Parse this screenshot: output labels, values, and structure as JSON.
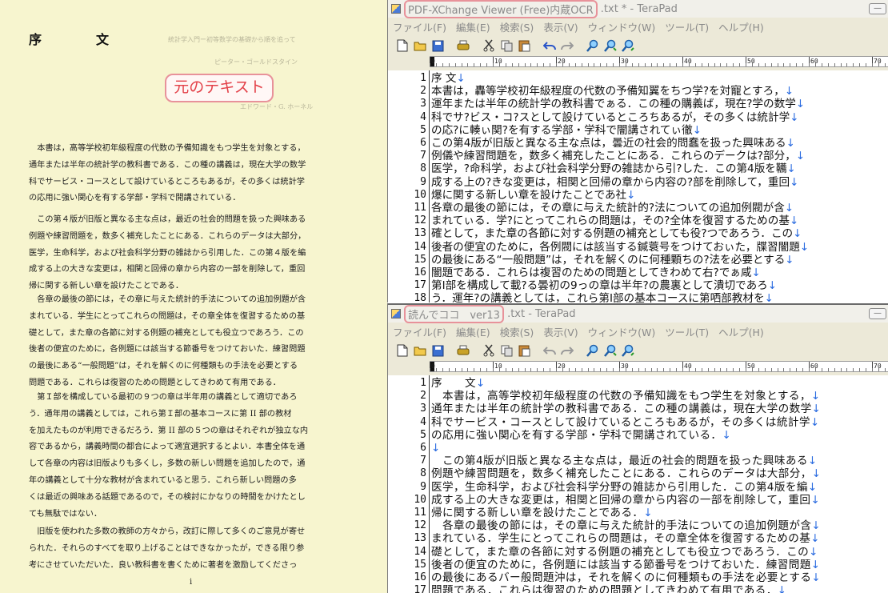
{
  "scan": {
    "heading": "序　文",
    "ghost_lines": [
      "統計学入門ー初等数学の基礎から順を追って",
      "ピーター・ゴールドスタイン",
      "エドワード・G. ホーネル"
    ],
    "callout": "元のテキスト",
    "paragraphs": [
      [
        "本書は，高等学校初年級程度の代数の予備知識をもつ学生を対象とする，",
        "通年または半年の統計学の教科書である．この種の講義は，現在大学の数学",
        "科でサービス・コースとして設けているところもあるが，その多くは統計学",
        "の応用に強い関心を有する学部・学科で開講されている．"
      ],
      [
        "この第４版が旧版と異なる主な点は，最近の社会的問題を扱った興味ある",
        "例題や練習問題を，数多く補充したことにある．これらのデータは大部分，",
        "医学，生命科学，および社会科学分野の雑誌から引用した．この第４版を編",
        "成する上の大きな変更は，相関と回帰の章から内容の一部を削除して，重回",
        "帰に関する新しい章を設けたことである．"
      ],
      [
        "各章の最後の節には，その章に与えた統計的手法についての追加例題が含",
        "まれている．学生にとってこれらの問題は，その章全体を復習するための基",
        "礎として，また章の各節に対する例題の補充としても役立つであろう．この",
        "後者の便宜のために，各例題には該当する節番号をつけておいた．練習問題",
        "の最後にある“一般問題”は，それを解くのに何種類もの手法を必要とする",
        "問題である．これらは復習のための問題としてきわめて有用である．"
      ],
      [
        "第Ｉ部を構成している最初の９つの章は半年用の講義として適切であろ",
        "う．通年用の講義としては，これら第Ｉ部の基本コースに第 II 部の教材",
        "を加えたものが利用できるだろう．第 II 部の５つの章はそれぞれが独立な内",
        "容であるから，講義時間の都合によって適宜選択するとよい．本書全体を通",
        "して各章の内容は旧版よりも多くし，多数の新しい問題を追加したので，通",
        "年の講義として十分な教材が含まれていると思う．これら新しい問題の多",
        "くは最近の興味ある話題であるので，その検討にかなりの時間をかけたとし",
        "ても無駄ではない．"
      ],
      [
        "旧版を使われた多数の教師の方々から，改訂に際して多くのご意見が寄せ",
        "られた．それらのすべてを取り上げることはできなかったが，できる限り参",
        "考にさせていただいた．良い教科書を書くために著者を激励してくださっ"
      ]
    ],
    "page_number": "i"
  },
  "window1": {
    "title_highlight": "PDF-XChange Viewer (Free)内蔵OCR",
    "title_rest": " .txt * - TeraPad",
    "menu": [
      "ファイル(F)",
      "編集(E)",
      "検索(S)",
      "表示(V)",
      "ウィンドウ(W)",
      "ツール(T)",
      "ヘルプ(H)"
    ],
    "ruler_marks": [
      "0",
      "10",
      "20",
      "30",
      "40",
      "50",
      "60",
      "70"
    ],
    "lines": [
      {
        "n": "1",
        "t": "序 文",
        "nl": "↓"
      },
      {
        "n": "2",
        "t": "本書は，轟等学校初年級程度の代数の予備知翼をちつ学?を対寵とすろ，",
        "nl": "↓"
      },
      {
        "n": "3",
        "t": "運年または半年の統計学の教科書でぁる．この種の購義ば，現在?学の数学",
        "nl": "↓"
      },
      {
        "n": "4",
        "t": "科でサ?ビス・コ?スとして設けているところちあるが，その多くは統計学",
        "nl": "↓"
      },
      {
        "n": "5",
        "t": "の応?に輳ぃ関?を有する学部・学科で闇講されてぃ徹",
        "nl": "↓"
      },
      {
        "n": "6",
        "t": "この第4版が旧版と異なる主な点は，曇近の社会的問蠢を扱った興味ある",
        "nl": "↓"
      },
      {
        "n": "7",
        "t": "例儀や練習問題を，数多く補充したことにある．これらのデークは?部分，",
        "nl": "↓"
      },
      {
        "n": "8",
        "t": "医学，?命科学，および社会科学分野の雑誌から引?した．この第4版を韉",
        "nl": "↓"
      },
      {
        "n": "9",
        "t": "成する上の?きな変更は，相関と回帰の章から内容の?部を削除して，重回",
        "nl": "↓"
      },
      {
        "n": "10",
        "t": "爆に関する新しい章を設けたことであ社",
        "nl": "↓"
      },
      {
        "n": "11",
        "t": "各章の最後の節には，その章に与えた統計的?法についての追加例閥が含",
        "nl": "↓"
      },
      {
        "n": "12",
        "t": "まれてぃる．学?にとってこれらの問題は，その?全体を復習するための基",
        "nl": "↓"
      },
      {
        "n": "13",
        "t": "確として，また章の各節に対する例題の補充としても役?つであろう．この",
        "nl": "↓"
      },
      {
        "n": "14",
        "t": "後者の便宜のために，各例閥には該当する鍼蓑号をつけておぃた，牒習闇題",
        "nl": "↓"
      },
      {
        "n": "15",
        "t": "の最後にある“一般問題”は，それを解くのに何種顆ちの?法を必要とする",
        "nl": "↓"
      },
      {
        "n": "16",
        "t": "闇題である．これらは複習のための問題としてきわめて右?でぁ咸",
        "nl": "↓"
      },
      {
        "n": "17",
        "t": "第I部を構成して載?る曇初の9っの章は半年?の農裏として潰切であろ",
        "nl": "↓"
      },
      {
        "n": "18",
        "t": "う．運年?の講義としては，これら第I部の基本コースに第哂部教材を",
        "nl": "↓"
      }
    ]
  },
  "window2": {
    "title_highlight": "読んでココ　ver13",
    "title_rest": " .txt - TeraPad",
    "menu": [
      "ファイル(F)",
      "編集(E)",
      "検索(S)",
      "表示(V)",
      "ウィンドウ(W)",
      "ツール(T)",
      "ヘルプ(H)"
    ],
    "ruler_marks": [
      "0",
      "10",
      "20",
      "30",
      "40",
      "50",
      "60",
      "70"
    ],
    "lines": [
      {
        "n": "1",
        "t": "序　　文",
        "nl": "↓"
      },
      {
        "n": "2",
        "t": "　本書は，高等学校初年級程度の代数の予備知識をもつ学生を対象とする，",
        "nl": "↓"
      },
      {
        "n": "3",
        "t": "通年または半年の統計学の教科書である．この種の講義は，現在大学の数学",
        "nl": "↓"
      },
      {
        "n": "4",
        "t": "科でサービス・コースとして設けているところもあるが，その多くは統計学",
        "nl": "↓"
      },
      {
        "n": "5",
        "t": "の応用に強い関心を有する学部・学科で開講されている．",
        "nl": "↓"
      },
      {
        "n": "6",
        "t": "",
        "nl": "↓"
      },
      {
        "n": "7",
        "t": "　この第4版が旧版と異なる主な点は，最近の社会的問題を扱った興味ある",
        "nl": "↓"
      },
      {
        "n": "8",
        "t": "例題や練習問題を，数多く補充したことにある．これらのデータは大部分，",
        "nl": "↓"
      },
      {
        "n": "9",
        "t": "医学，生命科学，および社会科学分野の雑誌から引用した．この第4版を編",
        "nl": "↓"
      },
      {
        "n": "10",
        "t": "成する上の大きな変更は，相関と回帰の章から内容の一部を削除して，重回",
        "nl": "↓"
      },
      {
        "n": "11",
        "t": "帰に関する新しい章を設けたことである．",
        "nl": "↓"
      },
      {
        "n": "12",
        "t": "　各章の最後の節には，その章に与えた統計的手法についての追加例題が含",
        "nl": "↓"
      },
      {
        "n": "13",
        "t": "まれている．学生にとってこれらの問題は，その章全体を復習するための基",
        "nl": "↓"
      },
      {
        "n": "14",
        "t": "礎として，また章の各節に対する例題の補充としても役立つであろう．この",
        "nl": "↓"
      },
      {
        "n": "15",
        "t": "後者の便宜のために，各例題には該当する節番号をつけておいた．練習問題",
        "nl": "↓"
      },
      {
        "n": "16",
        "t": "の最後にあるバー般問題沖は，それを解くのに何種類もの手法を必要とする",
        "nl": "↓"
      },
      {
        "n": "17",
        "t": "問題である．これらは復習のための問題としてきわめて有用である．",
        "nl": "↓"
      }
    ]
  },
  "toolbar_icons": [
    "new-file-icon",
    "open-folder-icon",
    "save-icon",
    "separator",
    "print-icon",
    "separator",
    "cut-icon",
    "copy-icon",
    "paste-icon",
    "separator",
    "undo-icon",
    "redo-icon",
    "separator",
    "find-icon",
    "find-next-icon",
    "find-prev-icon"
  ],
  "colors": {
    "highlight": "#e8929a",
    "callout_text": "#e34048",
    "newline_mark": "#2a6be0",
    "scan_bg": "#f7f5cf"
  }
}
